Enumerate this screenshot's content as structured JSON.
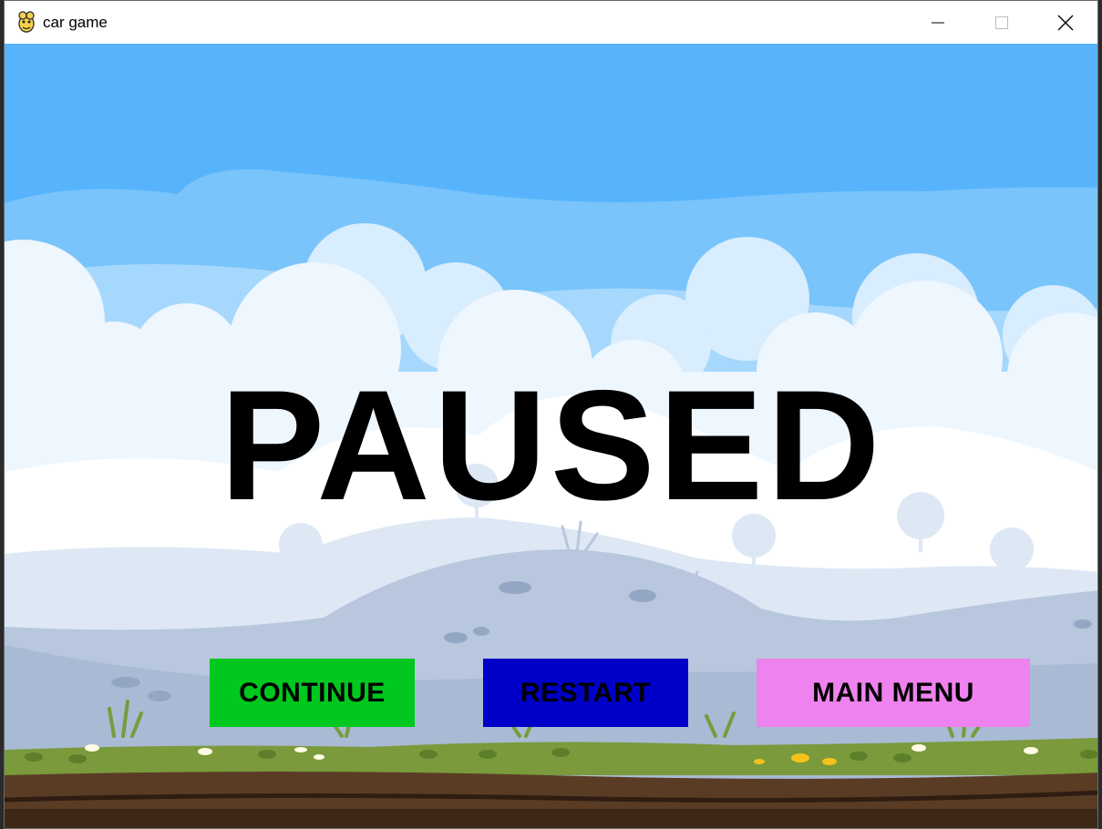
{
  "window": {
    "title": "car game",
    "app_icon": "pygame-snake-icon",
    "controls": [
      "minimize-icon",
      "maximize-icon",
      "close-icon"
    ]
  },
  "game": {
    "pause_title": "PAUSED",
    "buttons": {
      "continue": {
        "label": "CONTINUE",
        "color": "#00c81e"
      },
      "restart": {
        "label": "RESTART",
        "color": "#0000c8"
      },
      "main_menu": {
        "label": "MAIN MENU",
        "color": "#ee82ee"
      }
    }
  },
  "colors": {
    "sky": "#57b4fc",
    "ground_grass": "#7a9a3c",
    "ground_dirt": "#4a3322"
  }
}
